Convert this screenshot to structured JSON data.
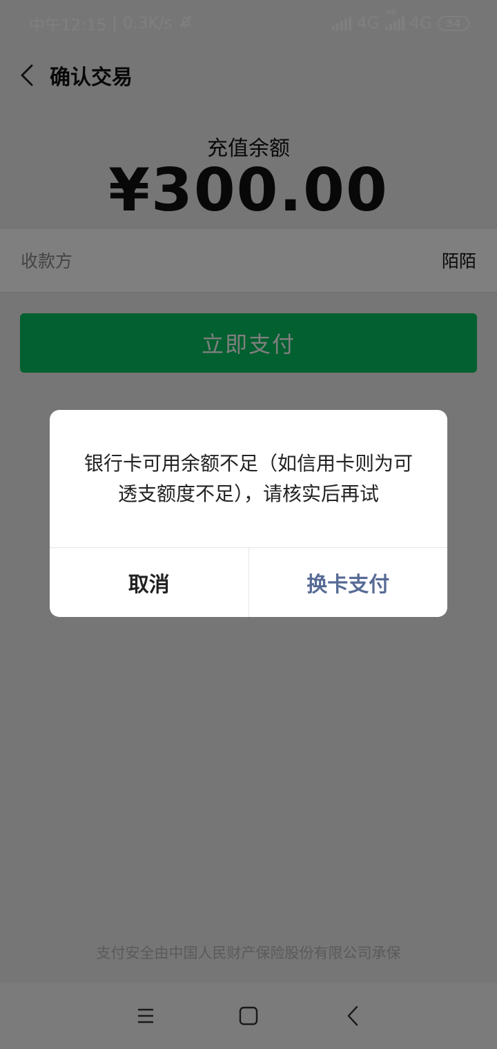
{
  "status_bar": {
    "time": "中午12:15",
    "separator": "|",
    "net_speed": "0.3K/s",
    "network_1": "4G",
    "network_2": "4G",
    "hd_label": "HD",
    "battery": "54"
  },
  "header": {
    "title": "确认交易"
  },
  "amount": {
    "label": "充值余额",
    "value": "¥300.00"
  },
  "payee": {
    "label": "收款方",
    "value": "陌陌"
  },
  "pay_button": {
    "label": "立即支付",
    "color": "#07c160"
  },
  "footer": {
    "text": "支付安全由中国人民财产保险股份有限公司承保"
  },
  "dialog": {
    "message": "银行卡可用余额不足（如信用卡则为可透支额度不足），请核实后再试",
    "cancel_label": "取消",
    "confirm_label": "换卡支付",
    "confirm_color": "#576b95"
  },
  "navigation_bar": {
    "icons": [
      "menu-icon",
      "home-icon",
      "back-icon"
    ]
  }
}
